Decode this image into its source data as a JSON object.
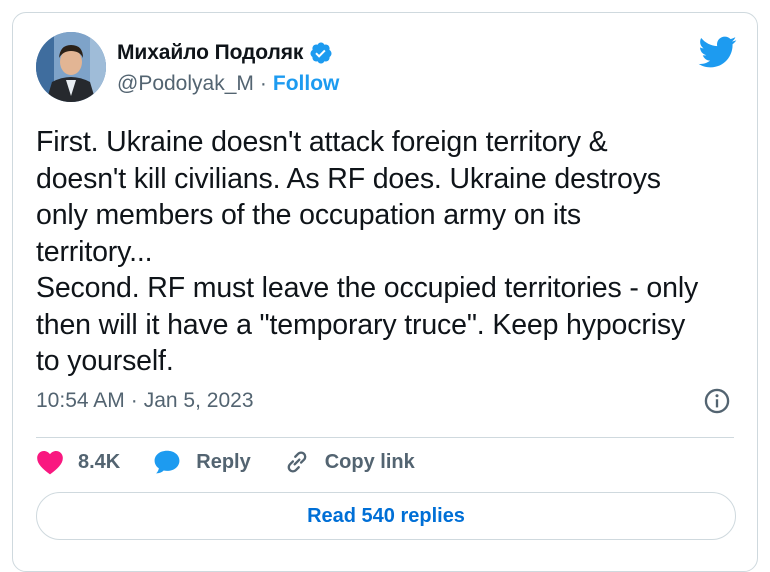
{
  "tweet": {
    "author": {
      "name": "Михайло Подоляк",
      "handle": "@Podolyak_M",
      "separator": "·",
      "follow_label": "Follow"
    },
    "text": "First. Ukraine doesn't attack foreign territory &\ndoesn't kill civilians. As RF does. Ukraine destroys\nonly members of the occupation army on its\nterritory...\nSecond. RF must leave the occupied territories - only\nthen will it have a \"temporary truce\". Keep hypocrisy\nto yourself.",
    "time": "10:54 AM",
    "time_separator": "·",
    "date": "Jan 5, 2023"
  },
  "actions": {
    "like_count": "8.4K",
    "reply_label": "Reply",
    "copy_link_label": "Copy link"
  },
  "read_replies_label": "Read 540 replies",
  "colors": {
    "accent": "#1d9bf0",
    "like": "#f91880",
    "text": "#0f1419",
    "muted": "#536471",
    "border": "#cfd9de"
  },
  "icons": [
    "verified-badge-icon",
    "twitter-bird-icon",
    "info-icon",
    "heart-icon",
    "reply-bubble-icon",
    "link-icon"
  ]
}
